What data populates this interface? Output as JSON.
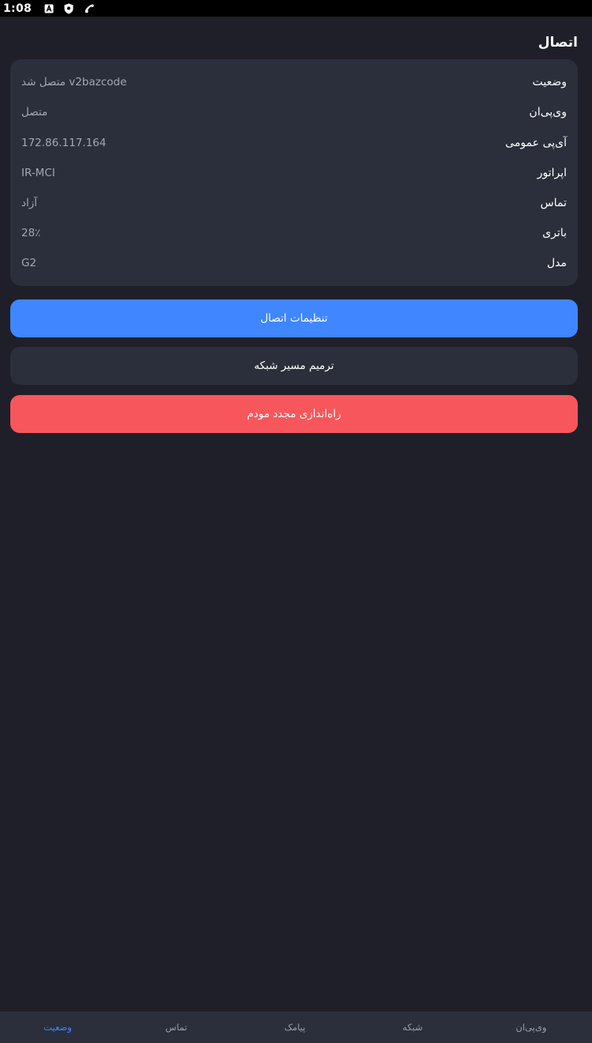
{
  "status_bar": {
    "time": "1:08",
    "icons": [
      "a-box-icon",
      "shield-icon",
      "phone-icon"
    ]
  },
  "section": {
    "title": "اتصال"
  },
  "info": {
    "rows": [
      {
        "label": "وضعیت",
        "value": "متصل شد v2bazcode"
      },
      {
        "label": "وی‌پی‌ان",
        "value": "متصل"
      },
      {
        "label": "آی‌پی عمومی",
        "value": "172.86.117.164"
      },
      {
        "label": "اپراتور",
        "value": "IR-MCI"
      },
      {
        "label": "تماس",
        "value": "آزاد"
      },
      {
        "label": "باتری",
        "value": "28٪"
      },
      {
        "label": "مدل",
        "value": "G2"
      }
    ]
  },
  "buttons": {
    "settings": "تنظیمات اتصال",
    "repair": "ترمیم مسیر شبکه",
    "restart": "راه‌اندازی مجدد مودم"
  },
  "nav": {
    "status": "وضعیت",
    "call": "تماس",
    "sms": "پیامک",
    "network": "شبکه",
    "vpn": "وی‌پی‌ان"
  },
  "colors": {
    "background": "#1f1f29",
    "card": "#2b2f3b",
    "primary": "#3f86ff",
    "danger": "#f7575c",
    "muted": "#a3a7b2"
  }
}
